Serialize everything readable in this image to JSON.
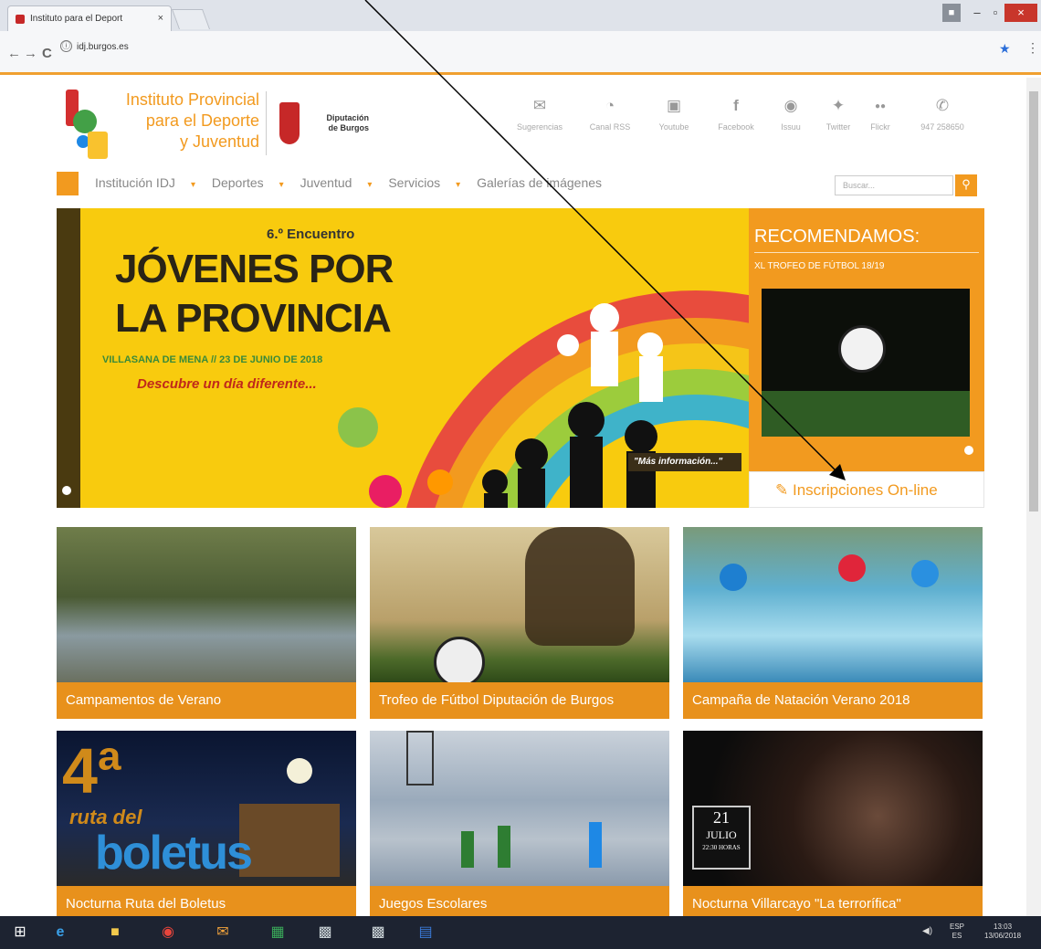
{
  "browser": {
    "tab_title": "Instituto para el Deport",
    "tab_close": "×",
    "url": "idj.burgos.es",
    "info_icon": "ⓘ",
    "back": "←",
    "forward": "→",
    "reload": "C",
    "star": "★",
    "menu": "⋮",
    "win_min": "–",
    "win_max": "▫",
    "win_close": "×"
  },
  "header": {
    "site_name_l1": "Instituto Provincial",
    "site_name_l2": "para el Deporte",
    "site_name_l3": "y Juventud",
    "dip_l1": "Diputación",
    "dip_l2": "de Burgos",
    "social": [
      {
        "icon": "envelope-icon",
        "glyph": "✉",
        "label": "Sugerencias"
      },
      {
        "icon": "rss-icon",
        "glyph": "◔",
        "label": "Canal RSS"
      },
      {
        "icon": "youtube-icon",
        "glyph": "▣",
        "label": "Youtube"
      },
      {
        "icon": "facebook-icon",
        "glyph": "f",
        "label": "Facebook"
      },
      {
        "icon": "issuu-icon",
        "glyph": "◉",
        "label": "Issuu"
      },
      {
        "icon": "twitter-icon",
        "glyph": "✦",
        "label": "Twitter"
      },
      {
        "icon": "flickr-icon",
        "glyph": "●●",
        "label": "Flickr"
      },
      {
        "icon": "phone-icon",
        "glyph": "✆",
        "label": "947 258650"
      }
    ]
  },
  "nav": {
    "items": [
      {
        "label": "Institución IDJ",
        "caret": "▾"
      },
      {
        "label": "Deportes",
        "caret": "▾"
      },
      {
        "label": "Juventud",
        "caret": "▾"
      },
      {
        "label": "Servicios",
        "caret": "▾"
      },
      {
        "label": "Galerías de imágenes",
        "caret": ""
      }
    ],
    "search_placeholder": "Buscar...",
    "search_icon": "⚲"
  },
  "banner": {
    "subtitle": "6.º Encuentro",
    "title_l1": "JÓVENES POR",
    "title_l2": "LA PROVINCIA",
    "location": "VILLASANA DE MENA // 23 DE JUNIO DE 2018",
    "tagline": "Descubre un día diferente...",
    "more": "\"Más información...\""
  },
  "recommend": {
    "title": "RECOMENDAMOS:",
    "subtitle": "XL TROFEO DE FÚTBOL 18/19",
    "online_icon": "✎",
    "online_label": "Inscripciones On-line"
  },
  "tiles": [
    {
      "caption": "Campamentos de Verano",
      "colors": [
        "#5c6b3b",
        "#8a9a6a",
        "#4d5a3a"
      ]
    },
    {
      "caption": "Trofeo de Fútbol Diputación de Burgos",
      "colors": [
        "#c9b48a",
        "#6b5a36",
        "#9b7a46"
      ]
    },
    {
      "caption": "Campaña de Natación Verano 2018",
      "colors": [
        "#4fa0c8",
        "#9fd2e8",
        "#3a7eaa"
      ]
    },
    {
      "caption": "Nocturna Ruta del Boletus",
      "colors": [
        "#0d1a35",
        "#1f2f55",
        "#b07020"
      ]
    },
    {
      "caption": "Juegos Escolares",
      "colors": [
        "#aab6c4",
        "#7e95b0",
        "#c9ced6"
      ]
    },
    {
      "caption": "Nocturna Villarcayo \"La terrorífica\"",
      "colors": [
        "#141414",
        "#3a2a20",
        "#5a3a2a"
      ]
    }
  ],
  "tile_texts": {
    "boletus_big": "4ª",
    "boletus_word": "boletus",
    "boletus_ruta": "ruta del",
    "villarcayo_day": "21",
    "villarcayo_month": "JULIO",
    "villarcayo_time": "22:30 HORAS"
  },
  "taskbar": {
    "lang": "ESP",
    "lang2": "ES",
    "time": "13:03",
    "date": "13/06/2018",
    "volume": "◀)"
  }
}
